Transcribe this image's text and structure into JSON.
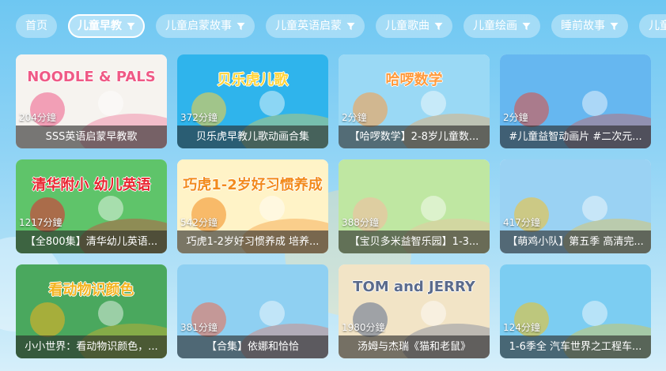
{
  "tabs": [
    {
      "label": "首页",
      "filter": false,
      "active": false
    },
    {
      "label": "儿童早教",
      "filter": true,
      "active": true
    },
    {
      "label": "儿童启蒙故事",
      "filter": true,
      "active": false
    },
    {
      "label": "儿童英语启蒙",
      "filter": true,
      "active": false
    },
    {
      "label": "儿童歌曲",
      "filter": true,
      "active": false
    },
    {
      "label": "儿童绘画",
      "filter": true,
      "active": false
    },
    {
      "label": "睡前故事",
      "filter": true,
      "active": false
    },
    {
      "label": "儿童",
      "filter": false,
      "active": false
    }
  ],
  "filter_icon": "funnel-icon",
  "cards": [
    {
      "duration": "204分鐘",
      "title": "SSS英语启蒙早教歌",
      "art_text": "NOODLE & PALS",
      "colors": [
        "#f6f3ef",
        "#ef5a86"
      ]
    },
    {
      "duration": "372分鐘",
      "title": "贝乐虎早教儿歌动画合集",
      "art_text": "贝乐虎儿歌",
      "colors": [
        "#2fb4ec",
        "#ffd43b"
      ]
    },
    {
      "duration": "2分鐘",
      "title": "【哈啰数学】2-8岁儿童数...",
      "art_text": "哈啰数学",
      "colors": [
        "#9ad9f5",
        "#ff9a3c"
      ]
    },
    {
      "duration": "2分鐘",
      "title": "#儿童益智动画片 #二次元...",
      "art_text": "",
      "colors": [
        "#66b7f0",
        "#e14b3b"
      ]
    },
    {
      "duration": "1217分鐘",
      "title": "【全800集】清华幼儿英语...",
      "art_text": "清华附小 幼儿英语",
      "colors": [
        "#5fc46a",
        "#e8242f"
      ]
    },
    {
      "duration": "542分鐘",
      "title": "巧虎1-2岁好习惯养成 培养...",
      "art_text": "巧虎1-2岁好习惯养成",
      "colors": [
        "#fff3c7",
        "#f28a1c"
      ]
    },
    {
      "duration": "388分鐘",
      "title": "【宝贝多米益智乐园】1-3...",
      "art_text": "",
      "colors": [
        "#bfe7a2",
        "#f7b9a0"
      ]
    },
    {
      "duration": "417分鐘",
      "title": "【萌鸡小队】第五季 高清完...",
      "art_text": "",
      "colors": [
        "#9ad2f3",
        "#f6c12a"
      ]
    },
    {
      "duration": "",
      "title": "小小世界：看动物识颜色，...",
      "art_text": "看动物识颜色",
      "colors": [
        "#4aa85e",
        "#f3b31f"
      ]
    },
    {
      "duration": "381分鐘",
      "title": "【合集】依娜和恰恰",
      "art_text": "",
      "colors": [
        "#8fd0f2",
        "#f06a4d"
      ]
    },
    {
      "duration": "1980分鐘",
      "title": "汤姆与杰瑞《猫和老鼠》",
      "art_text": "TOM and JERRY",
      "colors": [
        "#f2e4c6",
        "#5b6b8c"
      ]
    },
    {
      "duration": "124分鐘",
      "title": "1-6季全 汽车世界之工程车...",
      "art_text": "",
      "colors": [
        "#7ccdf2",
        "#f3c21d"
      ]
    }
  ]
}
